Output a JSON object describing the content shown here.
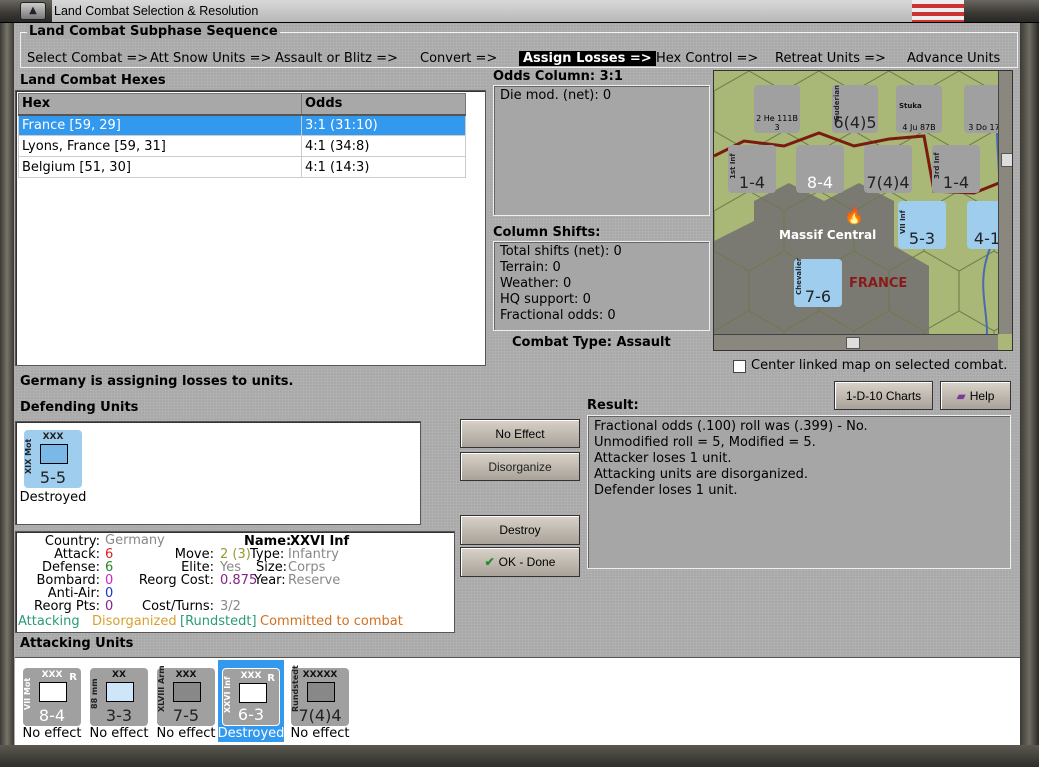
{
  "window": {
    "title": "Land Combat Selection & Resolution"
  },
  "subphase": {
    "title": "Land Combat Subphase Sequence",
    "steps": [
      "Select Combat =>",
      "Att Snow Units =>",
      "Assault or Blitz =>",
      "Convert =>",
      "Assign Losses =>",
      "Hex Control =>",
      "Retreat Units =>",
      "Advance Units"
    ],
    "active_index": 4
  },
  "hexes": {
    "title": "Land Combat Hexes",
    "columns": [
      "Hex",
      "Odds"
    ],
    "rows": [
      {
        "hex": "France [59, 29]",
        "odds": "3:1 (31:10)"
      },
      {
        "hex": "Lyons, France [59, 31]",
        "odds": "4:1 (34:8)"
      },
      {
        "hex": "Belgium [51, 30]",
        "odds": "4:1 (14:3)"
      }
    ],
    "selected": 0
  },
  "odds": {
    "title": "Odds Column: 3:1",
    "die_mod": "Die mod. (net): 0"
  },
  "shifts": {
    "title": "Column Shifts:",
    "lines": [
      "Total shifts (net): 0",
      "Terrain: 0",
      "Weather: 0",
      "HQ support: 0",
      "Fractional odds: 0"
    ]
  },
  "combat_type": "Combat Type:  Assault",
  "map": {
    "labels": [
      "Massif Central",
      "FRANCE"
    ],
    "counters": [
      {
        "name": "He 111B",
        "val": "2 He 111B 3"
      },
      {
        "name": "Guderian",
        "val": "6(4)5"
      },
      {
        "name": "Stuka",
        "val": "4 Ju 87B"
      },
      {
        "name": "Do 17",
        "val": "3 Do 17"
      },
      {
        "name": "1st Inf",
        "val": "1-4"
      },
      {
        "name": "VII Mot",
        "val": "8-4"
      },
      {
        "name": "Rundstedt",
        "val": "7(4)4"
      },
      {
        "name": "3rd Inf",
        "val": "1-4"
      },
      {
        "name": "VII Inf",
        "val": "5-3"
      },
      {
        "name": "Lyons",
        "val": "4-1"
      },
      {
        "name": "Chevalier",
        "val": "7-6"
      }
    ]
  },
  "center_checkbox": {
    "label": "Center linked map on selected combat.",
    "checked": false
  },
  "status": "Germany is assigning losses to units.",
  "buttons": {
    "charts": "1-D-10 Charts",
    "help": "Help",
    "no_effect": "No Effect",
    "disorganize": "Disorganize",
    "destroy": "Destroy",
    "ok": "OK - Done"
  },
  "defending": {
    "title": "Defending Units",
    "units": [
      {
        "name": "XIX Mot",
        "size": "XXX",
        "strength": "5-5",
        "result": "Destroyed"
      }
    ]
  },
  "result": {
    "title": "Result:",
    "lines": [
      "Fractional odds (.100) roll was (.399)  - No.",
      "Unmodified roll = 5, Modified = 5.",
      "Attacker loses 1 unit.",
      "Attacking units are disorganized.",
      "Defender loses 1 unit."
    ]
  },
  "info": {
    "country_l": "Country:",
    "country": "Germany",
    "attack_l": "Attack:",
    "attack": "6",
    "defense_l": "Defense:",
    "defense": "6",
    "bombard_l": "Bombard:",
    "bombard": "0",
    "aa_l": "Anti-Air:",
    "aa": "0",
    "reorg_l": "Reorg Pts:",
    "reorg": "0",
    "name_l": "Name:",
    "name": "XXVI Inf",
    "move_l": "Move:",
    "move": "2 (3)",
    "type_l": "Type:",
    "type": "Infantry",
    "elite_l": "Elite:",
    "elite": "Yes",
    "size_l": "Size:",
    "size": "Corps",
    "rcost_l": "Reorg Cost:",
    "rcost": "0.875",
    "year_l": "Year:",
    "year": "Reserve",
    "ct_l": "Cost/Turns:",
    "ct": "3/2",
    "s1": "Attacking",
    "s2": "Disorganized",
    "s3": "[Rundstedt]",
    "s4": "Committed to combat"
  },
  "attacking": {
    "title": "Attacking Units",
    "units": [
      {
        "name": "VII Mot",
        "size": "XXX",
        "strength": "8-4",
        "result": "No effect"
      },
      {
        "name": "88 mm",
        "size": "XX",
        "strength": "3-3",
        "result": "No effect"
      },
      {
        "name": "XLVIII Arm",
        "size": "XXX",
        "strength": "7-5",
        "result": "No effect"
      },
      {
        "name": "XXVI Inf",
        "size": "XXX",
        "strength": "6-3",
        "result": "Destroyed"
      },
      {
        "name": "Rundstedt",
        "size": "XXXXX",
        "strength": "7(4)4",
        "result": "No effect"
      }
    ],
    "selected": 3
  },
  "colors": {
    "selection": "#3399ee",
    "attack": "#dd2222",
    "defense": "#228822",
    "bombard": "#cc22cc",
    "aa": "#2233cc"
  }
}
